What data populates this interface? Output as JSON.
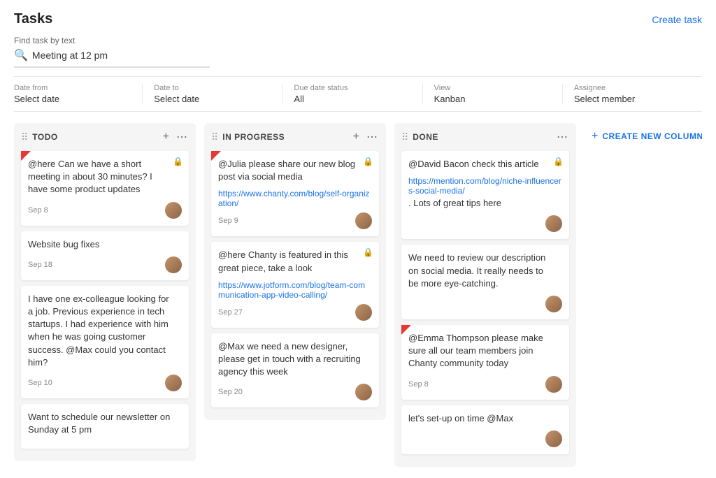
{
  "header": {
    "title": "Tasks",
    "create_task_label": "Create task"
  },
  "search": {
    "label": "Find task by text",
    "value": "Meeting at 12 pm",
    "placeholder": "Meeting at 12 pm"
  },
  "filters": [
    {
      "label": "Date from",
      "value": "Select date"
    },
    {
      "label": "Date to",
      "value": "Select date"
    },
    {
      "label": "Due date status",
      "value": "All"
    },
    {
      "label": "View",
      "value": "Kanban"
    },
    {
      "label": "Assignee",
      "value": "Select member"
    }
  ],
  "columns": [
    {
      "id": "todo",
      "title": "TODO",
      "cards": [
        {
          "id": 1,
          "text": "@here Can we have a short meeting in about 30 minutes? I have some product updates",
          "date": "Sep 8",
          "has_flag": true,
          "has_lock": true,
          "has_avatar": true
        },
        {
          "id": 2,
          "text": "Website bug fixes",
          "date": "Sep 18",
          "has_flag": false,
          "has_lock": false,
          "has_avatar": true
        },
        {
          "id": 3,
          "text": "I have one ex-colleague looking for a job. Previous experience in tech startups. I had experience with him when he was going customer success. @Max could you contact him?",
          "date": "Sep 10",
          "has_flag": false,
          "has_lock": false,
          "has_avatar": true
        },
        {
          "id": 4,
          "text": "Want to schedule our newsletter on Sunday at 5 pm",
          "date": "",
          "has_flag": false,
          "has_lock": false,
          "has_avatar": false
        }
      ]
    },
    {
      "id": "in-progress",
      "title": "IN PROGRESS",
      "cards": [
        {
          "id": 5,
          "text": "@Julia please share our new blog post via social media",
          "link": "https://www.chanty.com/blog/self-organization/",
          "date": "Sep 9",
          "has_flag": true,
          "has_lock": true,
          "has_avatar": true
        },
        {
          "id": 6,
          "text": "@here Chanty is featured in this great piece, take a look",
          "link": "https://www.jotform.com/blog/team-communication-app-video-calling/",
          "date": "Sep 27",
          "has_flag": false,
          "has_lock": true,
          "has_avatar": true
        },
        {
          "id": 7,
          "text": "@Max we need a new designer, please get in touch with a recruiting agency this week",
          "date": "Sep 20",
          "has_flag": false,
          "has_lock": false,
          "has_avatar": true
        }
      ]
    },
    {
      "id": "done",
      "title": "DONE",
      "cards": [
        {
          "id": 8,
          "text": "@David Bacon check this article",
          "link": "https://mention.com/blog/niche-influencers-social-media/",
          "link_suffix": " . Lots of great tips here",
          "date": "",
          "has_flag": false,
          "has_lock": true,
          "has_avatar": true
        },
        {
          "id": 9,
          "text": "We need to review our description on social media. It really needs to be more eye-catching.",
          "date": "",
          "has_flag": false,
          "has_lock": false,
          "has_avatar": true
        },
        {
          "id": 10,
          "text": "@Emma Thompson please make sure all our team members join Chanty community today",
          "date": "Sep 8",
          "has_flag": true,
          "has_lock": false,
          "has_avatar": true
        },
        {
          "id": 11,
          "text": "let's set-up on time @Max",
          "date": "",
          "has_flag": false,
          "has_lock": false,
          "has_avatar": true
        }
      ]
    }
  ],
  "new_column_label": "CREATE NEW COLUMN"
}
